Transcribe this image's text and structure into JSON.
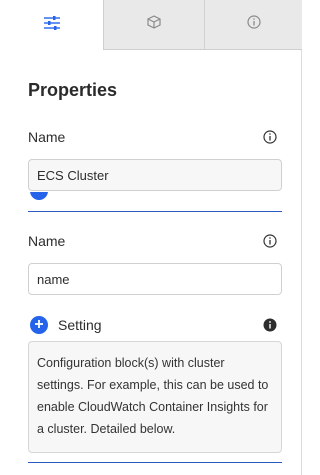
{
  "tabs": [
    {
      "icon": "sliders-icon",
      "active": true
    },
    {
      "icon": "cube-icon",
      "active": false
    },
    {
      "icon": "info-icon",
      "active": false
    }
  ],
  "panel": {
    "title": "Properties",
    "fields": [
      {
        "label": "Name",
        "value": "ECS Cluster"
      },
      {
        "label": "Name",
        "value": "name"
      }
    ],
    "setting": {
      "label": "Setting",
      "description": "Configuration block(s) with cluster settings. For example, this can be used to enable CloudWatch Container Insights for a cluster. Detailed below."
    }
  },
  "colors": {
    "accent": "#2563eb",
    "tab_inactive": "#e9e9e9",
    "field_bg": "#f7f7f7"
  }
}
